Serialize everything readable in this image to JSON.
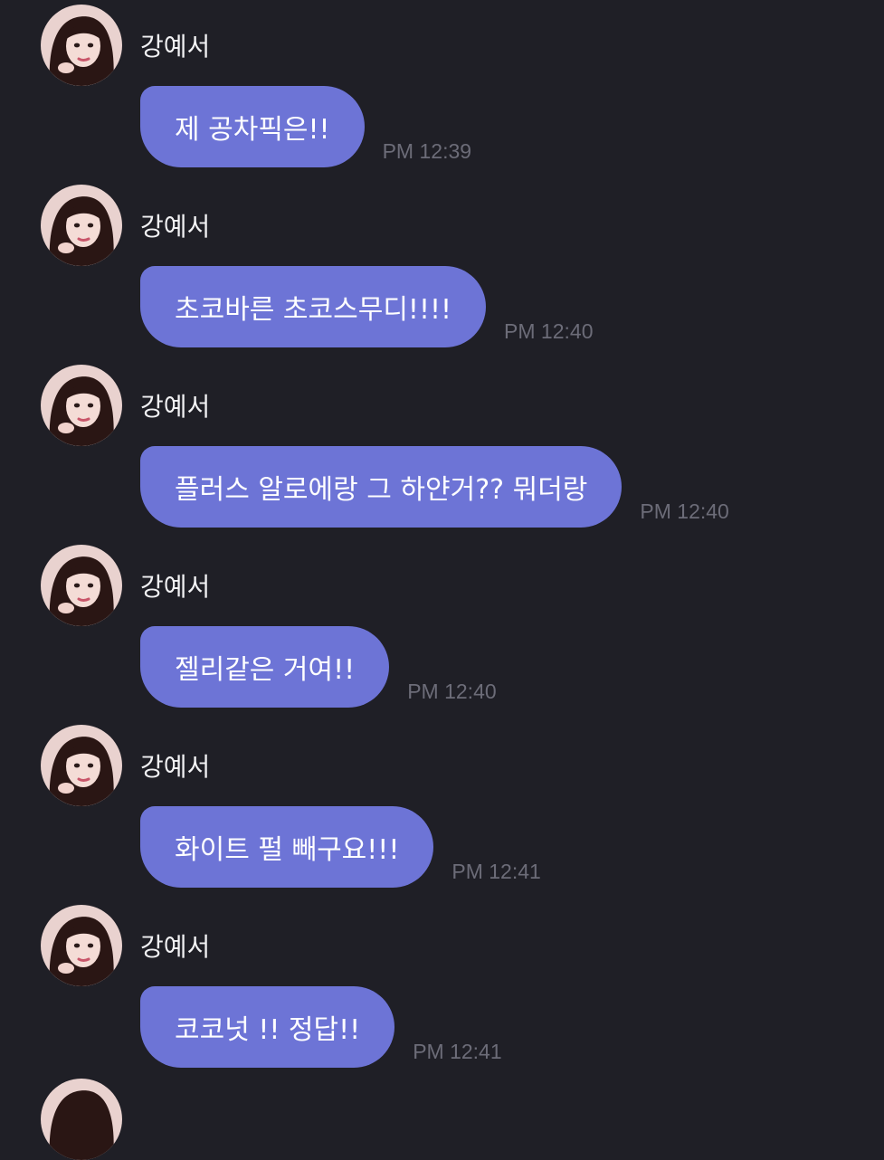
{
  "colors": {
    "background": "#1f1f26",
    "bubble": "#6d74d6",
    "bubble_text": "#ffffff",
    "sender_text": "#f2f2f4",
    "timestamp": "#6c6c78"
  },
  "messages": [
    {
      "sender": "강예서",
      "avatar": "profile-photo",
      "text": "제 공차픽은!!",
      "time": "PM 12:39"
    },
    {
      "sender": "강예서",
      "avatar": "profile-photo",
      "text": "초코바른 초코스무디!!!!",
      "time": "PM 12:40"
    },
    {
      "sender": "강예서",
      "avatar": "profile-photo",
      "text": "플러스 알로에랑 그 하얀거?? 뭐더랑",
      "time": "PM 12:40"
    },
    {
      "sender": "강예서",
      "avatar": "profile-photo",
      "text": "젤리같은 거여!!",
      "time": "PM 12:40"
    },
    {
      "sender": "강예서",
      "avatar": "profile-photo",
      "text": "화이트 펄 빼구요!!!",
      "time": "PM 12:41"
    },
    {
      "sender": "강예서",
      "avatar": "profile-photo",
      "text": "코코넛 !! 정답!!",
      "time": "PM 12:41"
    }
  ]
}
